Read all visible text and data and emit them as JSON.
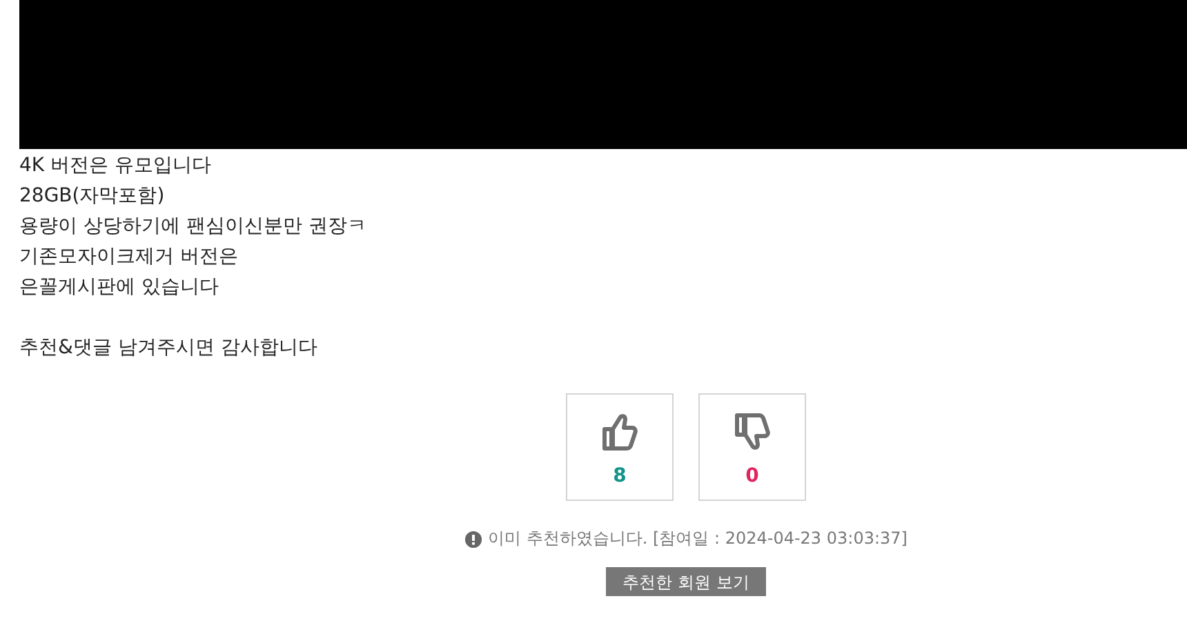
{
  "paragraphs": [
    [
      "4K 버전은 유모입니다",
      "28GB(자막포함)",
      "용량이 상당하기에 팬심이신분만 권장ㅋ",
      "기존모자이크제거 버전은",
      "은꼴게시판에 있습니다"
    ],
    [
      "추천&댓글 남겨주시면 감사합니다"
    ]
  ],
  "votes": [
    {
      "kind": "up",
      "count": "8"
    },
    {
      "kind": "down",
      "count": "0"
    }
  ],
  "notice": "이미 추천하였습니다. [참여일 : 2024-04-23 03:03:37]",
  "button": "추천한 회원 보기"
}
